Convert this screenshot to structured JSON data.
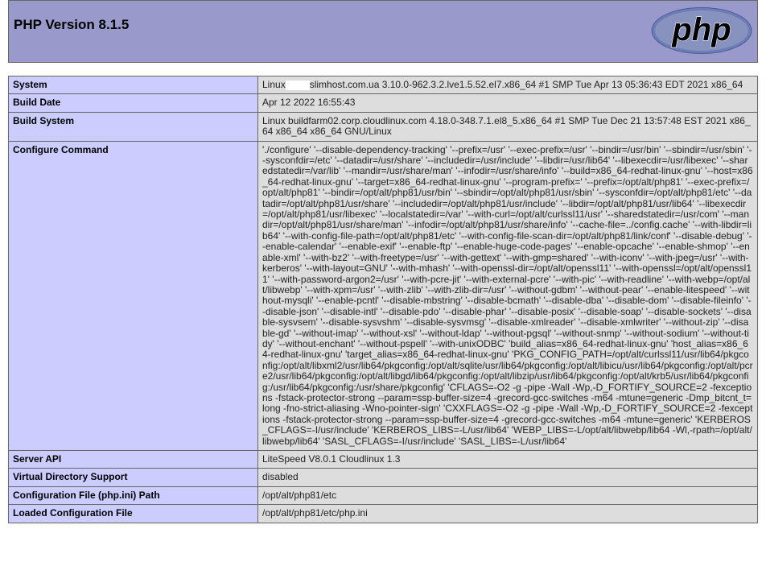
{
  "header": {
    "title": "PHP Version 8.1.5",
    "logo_text": "php",
    "logo_colors": {
      "outer": "#6c7eb7",
      "inner": "#8892bf",
      "text": "#000000"
    }
  },
  "rows": [
    {
      "key": "System",
      "value_prefix": "Linux",
      "value_suffix": "slimhost.com.ua 3.10.0-962.3.2.lve1.5.52.el7.x86_64 #1 SMP Tue Apr 13 05:36:43 EDT 2021 x86_64"
    },
    {
      "key": "Build Date",
      "value": "Apr 12 2022 16:55:43"
    },
    {
      "key": "Build System",
      "value": "Linux buildfarm02.corp.cloudlinux.com 4.18.0-348.7.1.el8_5.x86_64 #1 SMP Tue Dec 21 13:57:48 EST 2021 x86_64 x86_64 x86_64 GNU/Linux"
    },
    {
      "key": "Configure Command",
      "value": "'./configure' '--disable-dependency-tracking' '--prefix=/usr' '--exec-prefix=/usr' '--bindir=/usr/bin' '--sbindir=/usr/sbin' '--sysconfdir=/etc' '--datadir=/usr/share' '--includedir=/usr/include' '--libdir=/usr/lib64' '--libexecdir=/usr/libexec' '--sharedstatedir=/var/lib' '--mandir=/usr/share/man' '--infodir=/usr/share/info' '--build=x86_64-redhat-linux-gnu' '--host=x86_64-redhat-linux-gnu' '--target=x86_64-redhat-linux-gnu' '--program-prefix=' '--prefix=/opt/alt/php81' '--exec-prefix=/opt/alt/php81' '--bindir=/opt/alt/php81/usr/bin' '--sbindir=/opt/alt/php81/usr/sbin' '--sysconfdir=/opt/alt/php81/etc' '--datadir=/opt/alt/php81/usr/share' '--includedir=/opt/alt/php81/usr/include' '--libdir=/opt/alt/php81/usr/lib64' '--libexecdir=/opt/alt/php81/usr/libexec' '--localstatedir=/var' '--with-curl=/opt/alt/curlssl11/usr' '--sharedstatedir=/usr/com' '--mandir=/opt/alt/php81/usr/share/man' '--infodir=/opt/alt/php81/usr/share/info' '--cache-file=../config.cache' '--with-libdir=lib64' '--with-config-file-path=/opt/alt/php81/etc' '--with-config-file-scan-dir=/opt/alt/php81/link/conf' '--disable-debug' '--enable-calendar' '--enable-exif' '--enable-ftp' '--enable-huge-code-pages' '--enable-opcache' '--enable-shmop' '--enable-xml' '--with-bz2' '--with-freetype=/usr' '--with-gettext' '--with-gmp=shared' '--with-iconv' '--with-jpeg=/usr' '--with-kerberos' '--with-layout=GNU' '--with-mhash' '--with-openssl-dir=/opt/alt/openssl11' '--with-openssl=/opt/alt/openssl11' '--with-password-argon2=/usr' '--with-pcre-jit' '--with-external-pcre' '--with-pic' '--with-readline' '--with-webp=/opt/alt/libwebp' '--with-xpm=/usr' '--with-zlib' '--with-zlib-dir=/usr' '--without-gdbm' '--without-pear' '--enable-litespeed' '--without-mysqli' '--enable-pcntl' '--disable-mbstring' '--disable-bcmath' '--disable-dba' '--disable-dom' '--disable-fileinfo' '--disable-json' '--disable-intl' '--disable-pdo' '--disable-phar' '--disable-posix' '--disable-soap' '--disable-sockets' '--disable-sysvsem' '--disable-sysvshm' '--disable-sysvmsg' '--disable-xmlreader' '--disable-xmlwriter' '--without-zip' '--disable-gd' '--without-imap' '--without-xsl' '--without-ldap' '--without-pgsql' '--without-snmp' '--without-sodium' '--without-tidy' '--without-enchant' '--without-pspell' '--with-unixODBC' 'build_alias=x86_64-redhat-linux-gnu' 'host_alias=x86_64-redhat-linux-gnu' 'target_alias=x86_64-redhat-linux-gnu' 'PKG_CONFIG_PATH=/opt/alt/curlssl11/usr/lib64/pkgconfig:/opt/alt/libxml2/usr/lib64/pkgconfig:/opt/alt/sqlite/usr/lib64/pkgconfig:/opt/alt/libicu/usr/lib64/pkgconfig:/opt/alt/pcre2/usr/lib64/pkgconfig:/opt/alt/libgd/lib64/pkgconfig:/opt/alt/libzip/usr/lib64/pkgconfig:/opt/alt/krb5/usr/lib64/pkgconfig:/usr/lib64/pkgconfig:/usr/share/pkgconfig' 'CFLAGS=-O2 -g -pipe -Wall -Wp,-D_FORTIFY_SOURCE=2 -fexceptions -fstack-protector-strong --param=ssp-buffer-size=4 -grecord-gcc-switches -m64 -mtune=generic -Dmp_bitcnt_t=long -fno-strict-aliasing -Wno-pointer-sign' 'CXXFLAGS=-O2 -g -pipe -Wall -Wp,-D_FORTIFY_SOURCE=2 -fexceptions -fstack-protector-strong --param=ssp-buffer-size=4 -grecord-gcc-switches -m64 -mtune=generic' 'KERBEROS_CFLAGS=-I/usr/include' 'KERBEROS_LIBS=-L/usr/lib64' 'WEBP_LIBS=-L/opt/alt/libwebp/lib64 -Wl,-rpath=/opt/alt/libwebp/lib64' 'SASL_CFLAGS=-I/usr/include' 'SASL_LIBS=-L/usr/lib64'"
    },
    {
      "key": "Server API",
      "value": "LiteSpeed V8.0.1 Cloudlinux 1.3"
    },
    {
      "key": "Virtual Directory Support",
      "value": "disabled"
    },
    {
      "key": "Configuration File (php.ini) Path",
      "value": "/opt/alt/php81/etc"
    },
    {
      "key": "Loaded Configuration File",
      "value": "/opt/alt/php81/etc/php.ini"
    }
  ]
}
